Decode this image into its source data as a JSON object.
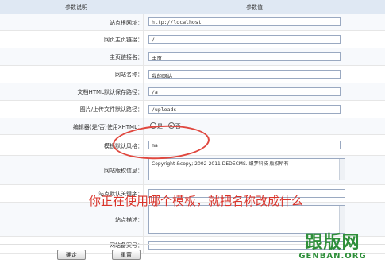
{
  "header": {
    "col_param": "参数说明",
    "col_value": "参数值"
  },
  "fields": [
    {
      "label": "站点根网址：",
      "value": "http://localhost"
    },
    {
      "label": "网页主页链接：",
      "value": "/"
    },
    {
      "label": "主页链接名：",
      "value": "主页"
    },
    {
      "label": "网站名称：",
      "value": "我的网站"
    },
    {
      "label": "文档HTML默认保存路径：",
      "value": "/a"
    },
    {
      "label": "图片/上传文件默认路径：",
      "value": "/uploads"
    },
    {
      "label": "编辑器(是/否)使用XHTML：",
      "radio_yes": "是",
      "radio_no": "否",
      "selected": "否"
    },
    {
      "label": "模板默认风格：",
      "value": "ma"
    },
    {
      "label": "网站版权信息：",
      "value": "Copyright &copy; 2002-2011 DEDECMS. 织梦科技 版权所有"
    },
    {
      "label": "站点默认关键字：",
      "value": ""
    },
    {
      "label": "站点描述：",
      "value": ""
    },
    {
      "label": "网站备案号：",
      "value": ""
    }
  ],
  "annotation": "你正在使用哪个模板，就把名称改成什么",
  "buttons": {
    "ok": "确定",
    "reset": "重置"
  },
  "watermark": {
    "cn": "跟版网",
    "en": "GENBAN.ORG"
  },
  "colors": {
    "annotation": "#d9342b",
    "watermark": "#2f8f3a",
    "header_bg": "#dfe8f3"
  }
}
